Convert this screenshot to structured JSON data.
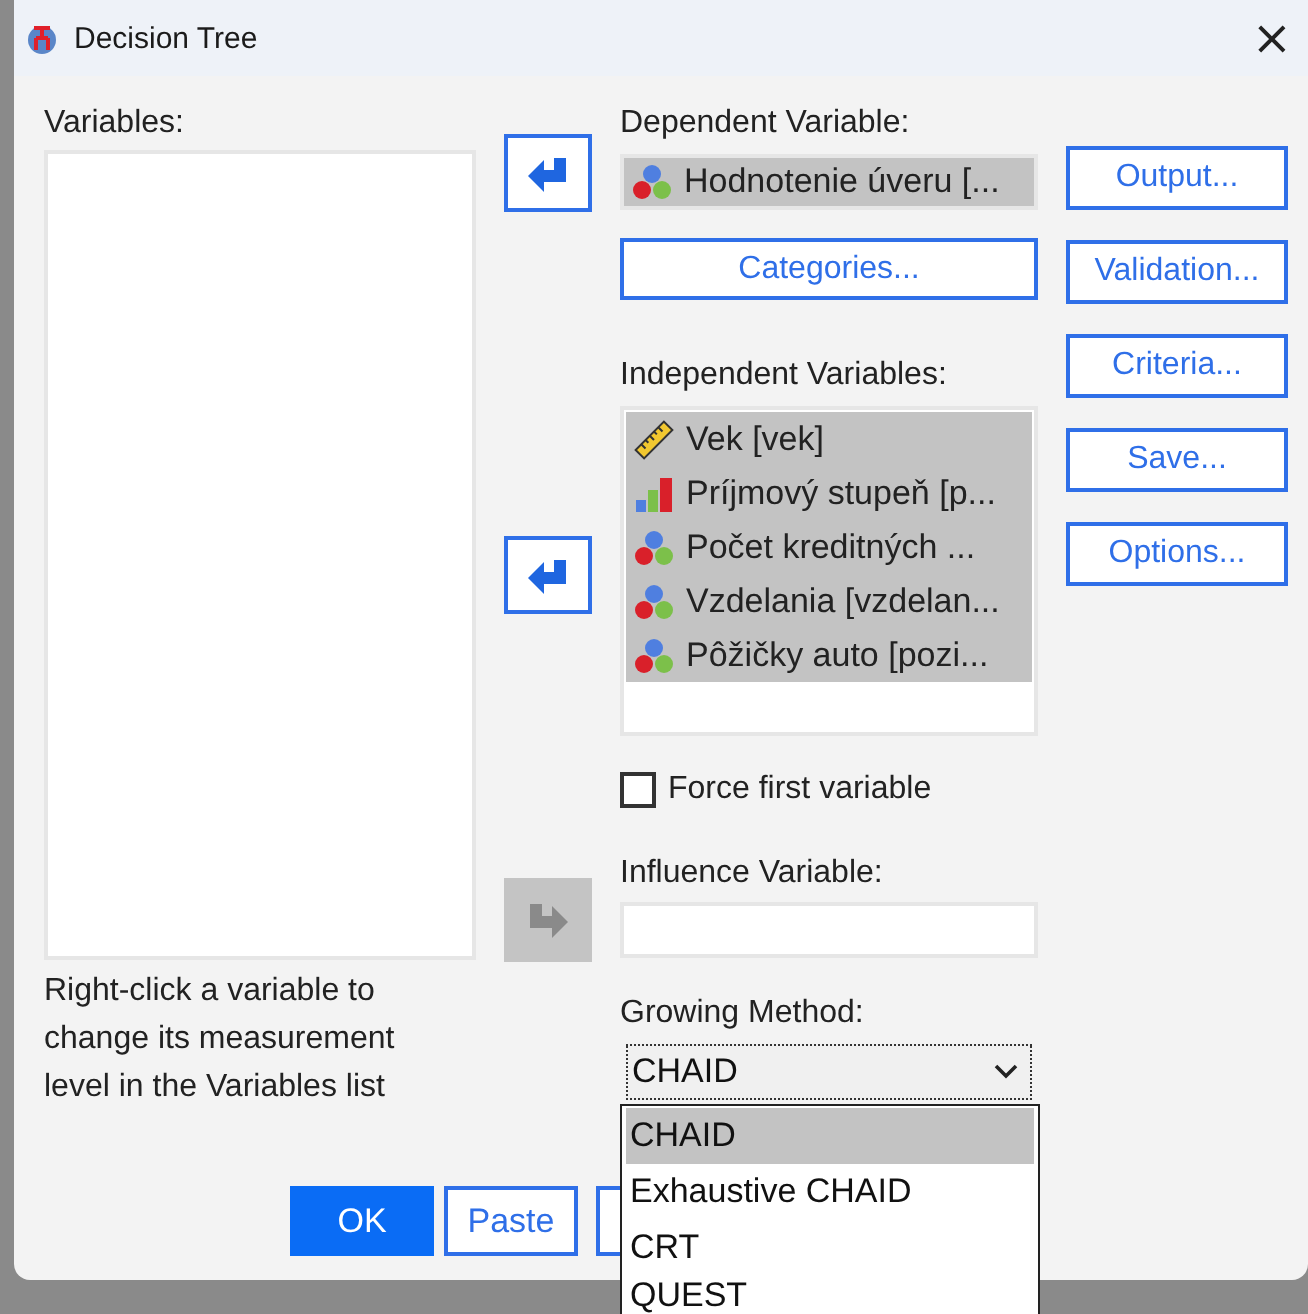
{
  "window": {
    "title": "Decision Tree",
    "close": "×"
  },
  "variables": {
    "label": "Variables:",
    "note": "Right-click a variable to change its measurement level in the Variables list"
  },
  "arrows": [
    {
      "kind": "left",
      "disabled": false
    },
    {
      "kind": "left",
      "disabled": false
    },
    {
      "kind": "right",
      "disabled": true
    }
  ],
  "dependent": {
    "label": "Dependent Variable:",
    "item": {
      "name": "Hodnotenie úveru [...",
      "kind": "nominal",
      "selected": true
    }
  },
  "categories_button": {
    "label": "Categories..."
  },
  "independent": {
    "label": "Independent Variables:",
    "items": [
      {
        "name": "Vek [vek]",
        "kind": "scale",
        "selected": true
      },
      {
        "name": "Príjmový stupeň [p...",
        "kind": "ordinal",
        "selected": true
      },
      {
        "name": "Počet kreditných ...",
        "kind": "nominal",
        "selected": true
      },
      {
        "name": "Vzdelania [vzdelan...",
        "kind": "nominal",
        "selected": true
      },
      {
        "name": "Pôžičky auto [pozi...",
        "kind": "nominal",
        "selected": true
      }
    ]
  },
  "force_first": {
    "label": "Force first variable",
    "checked": false
  },
  "influence": {
    "label": "Influence Variable:"
  },
  "growing_method": {
    "label": "Growing Method:",
    "value": "CHAID",
    "expanded": true,
    "options": [
      {
        "label": "CHAID",
        "selected": true
      },
      {
        "label": "Exhaustive CHAID",
        "selected": false
      },
      {
        "label": "CRT",
        "selected": false
      },
      {
        "label": "QUEST",
        "selected": false
      }
    ]
  },
  "side_buttons": [
    {
      "label": "Output..."
    },
    {
      "label": "Validation..."
    },
    {
      "label": "Criteria..."
    },
    {
      "label": "Save..."
    },
    {
      "label": "Options..."
    }
  ],
  "buttons": [
    {
      "label": "OK",
      "default": true
    },
    {
      "label": "Paste",
      "default": false
    }
  ]
}
